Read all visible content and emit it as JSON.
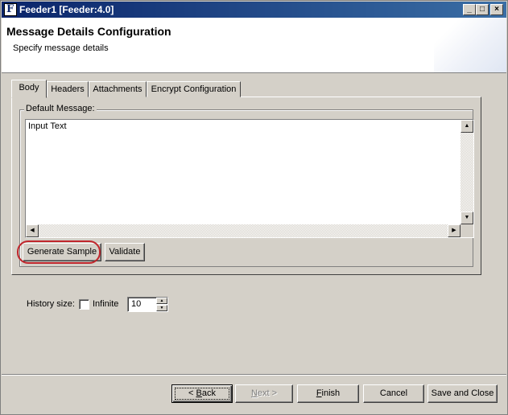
{
  "window": {
    "title": "Feeder1 [Feeder:4.0]",
    "app_icon_letter": "F",
    "minimize_glyph": "_",
    "maximize_glyph": "□",
    "close_glyph": "×"
  },
  "header": {
    "title": "Message Details Configuration",
    "subtitle": "Specify message details"
  },
  "tabs": [
    {
      "label": "Body",
      "active": true
    },
    {
      "label": "Headers",
      "active": false
    },
    {
      "label": "Attachments",
      "active": false
    },
    {
      "label": "Encrypt Configuration",
      "active": false
    }
  ],
  "body_tab": {
    "group_label": "Default Message:",
    "message_text": "Input Text",
    "generate_label": "Generate Sample",
    "validate_label": "Validate"
  },
  "history": {
    "label": "History size:",
    "infinite_label": "Infinite",
    "infinite_checked": false,
    "size_value": "10"
  },
  "footer": {
    "back_pre": "< ",
    "back_mnemonic": "B",
    "back_post": "ack",
    "next_mnemonic": "N",
    "next_post": "ext >",
    "finish_mnemonic": "F",
    "finish_post": "inish",
    "cancel_label": "Cancel",
    "save_close_label": "Save and Close"
  },
  "colors": {
    "titlebar_start": "#0a246a",
    "titlebar_end": "#3a6ea5",
    "annotation_ring": "#c0262c",
    "face": "#d4d0c8"
  }
}
